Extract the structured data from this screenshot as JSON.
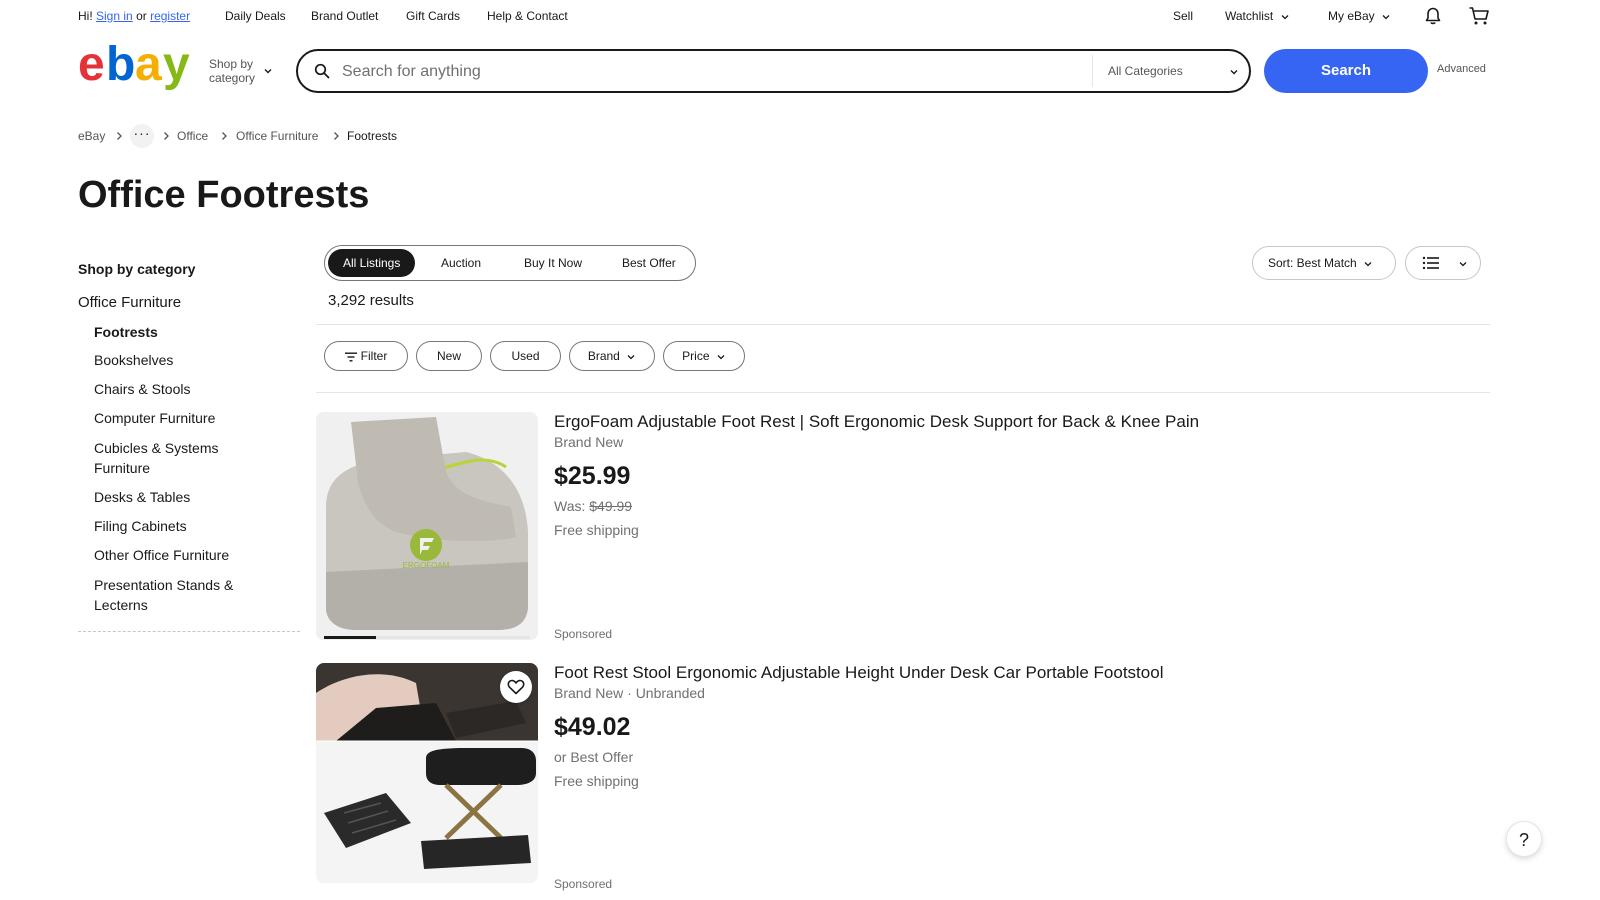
{
  "topbar": {
    "greeting": "Hi!",
    "signin": "Sign in",
    "or": "or",
    "register": "register",
    "links": [
      "Daily Deals",
      "Brand Outlet",
      "Gift Cards",
      "Help & Contact"
    ],
    "sell": "Sell",
    "watchlist": "Watchlist",
    "myebay": "My eBay"
  },
  "header": {
    "logo_letters": [
      "e",
      "b",
      "a",
      "y"
    ],
    "logo_colors": [
      "#e53238",
      "#0064d2",
      "#f5af02",
      "#86b817"
    ],
    "shop_by_category_line1": "Shop by",
    "shop_by_category_line2": "category",
    "search_placeholder": "Search for anything",
    "category_select": "All Categories",
    "search_button": "Search",
    "advanced": "Advanced",
    "accent_color": "#3665f3"
  },
  "breadcrumb": [
    "eBay",
    "Office",
    "Office Furniture",
    "Footrests"
  ],
  "page_title": "Office Footrests",
  "sidebar": {
    "heading": "Shop by category",
    "parent": "Office Furniture",
    "current": "Footrests",
    "items": [
      "Bookshelves",
      "Chairs & Stools",
      "Computer Furniture",
      "Cubicles & Systems Furniture",
      "Desks & Tables",
      "Filing Cabinets",
      "Other Office Furniture",
      "Presentation Stands & Lecterns"
    ]
  },
  "tabs": [
    "All Listings",
    "Auction",
    "Buy It Now",
    "Best Offer"
  ],
  "results_count": "3,292 results",
  "sort_label": "Sort: Best Match",
  "filters": [
    "Filter",
    "New",
    "Used",
    "Brand",
    "Price"
  ],
  "items": [
    {
      "title": "ErgoFoam Adjustable Foot Rest | Soft Ergonomic Desk Support for Back & Knee Pain",
      "condition": "Brand New",
      "price": "$25.99",
      "was_label": "Was:",
      "was_price": "$49.99",
      "shipping": "Free shipping",
      "sponsored": "Sponsored",
      "logo_text": "ERGOFOAM",
      "image_progress": 0.25
    },
    {
      "title": "Foot Rest Stool Ergonomic Adjustable Height Under Desk Car Portable Footstool",
      "condition": "Brand New · Unbranded",
      "price": "$49.02",
      "offer": "or Best Offer",
      "shipping": "Free shipping",
      "sponsored": "Sponsored"
    }
  ],
  "help_label": "?"
}
